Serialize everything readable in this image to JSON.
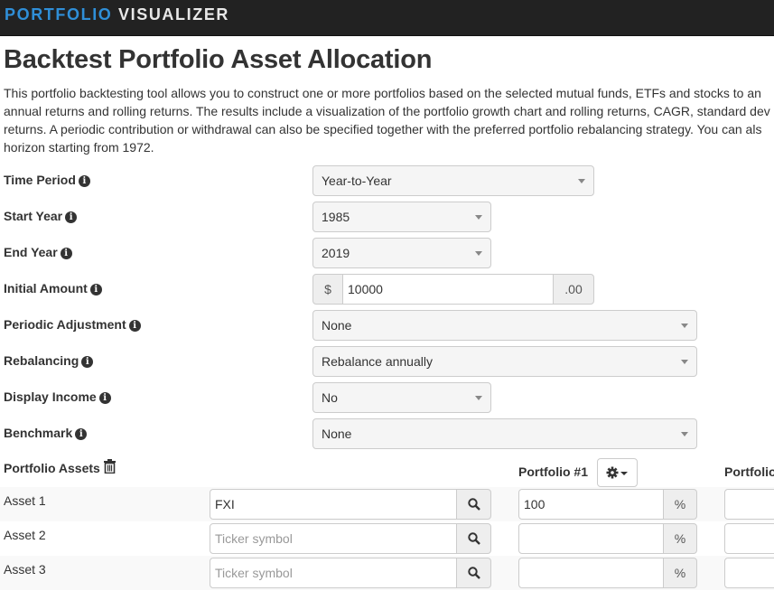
{
  "brand": {
    "part1": "PORTFOLIO",
    "part2": "VISUALIZER"
  },
  "title": "Backtest Portfolio Asset Allocation",
  "intro_lines": [
    "This portfolio backtesting tool allows you to construct one or more portfolios based on the selected mutual funds, ETFs and stocks to an",
    "annual returns and rolling returns. The results include a visualization of the portfolio growth chart and rolling returns, CAGR, standard dev",
    "returns. A periodic contribution or withdrawal can also be specified together with the preferred portfolio rebalancing strategy. You can als",
    "horizon starting from 1972."
  ],
  "form": {
    "time_period": {
      "label": "Time Period",
      "value": "Year-to-Year"
    },
    "start_year": {
      "label": "Start Year",
      "value": "1985"
    },
    "end_year": {
      "label": "End Year",
      "value": "2019"
    },
    "initial_amount": {
      "label": "Initial Amount",
      "prefix": "$",
      "value": "10000",
      "suffix": ".00"
    },
    "periodic_adjustment": {
      "label": "Periodic Adjustment",
      "value": "None"
    },
    "rebalancing": {
      "label": "Rebalancing",
      "value": "Rebalance annually"
    },
    "display_income": {
      "label": "Display Income",
      "value": "No"
    },
    "benchmark": {
      "label": "Benchmark",
      "value": "None"
    }
  },
  "assets": {
    "header": "Portfolio Assets",
    "portfolio1_header": "Portfolio #1",
    "portfolio2_header": "Portfolio",
    "percent_symbol": "%",
    "ticker_placeholder": "Ticker symbol",
    "rows": [
      {
        "label": "Asset 1",
        "ticker": "FXI",
        "alloc": "100"
      },
      {
        "label": "Asset 2",
        "ticker": "",
        "alloc": ""
      },
      {
        "label": "Asset 3",
        "ticker": "",
        "alloc": ""
      }
    ]
  },
  "icons": {
    "info": "info-circle-icon",
    "trash": "trash-icon",
    "search": "search-icon",
    "gear": "gear-icon",
    "caret": "caret-down-icon"
  },
  "colors": {
    "topbar": "#222222",
    "brand_accent": "#2f8fd8",
    "brand_text": "#e8e8e8"
  }
}
